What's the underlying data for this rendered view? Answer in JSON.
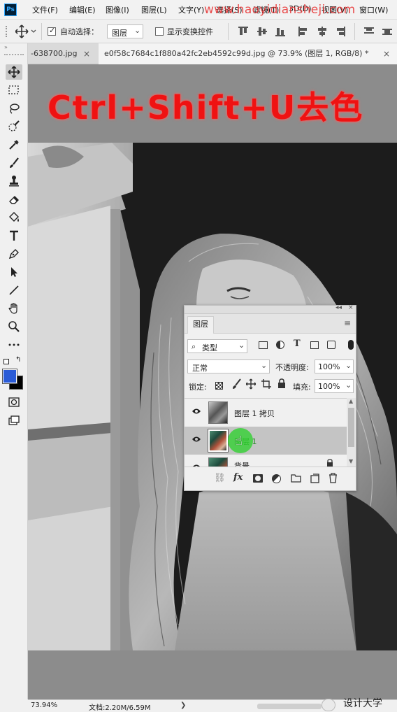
{
  "menubar": {
    "logo": "Ps",
    "items": [
      "文件(F)",
      "编辑(E)",
      "图像(I)",
      "图层(L)",
      "文字(Y)",
      "选择(S)",
      "滤镜(T)",
      "3D(D)",
      "视图(V)",
      "窗口(W)"
    ],
    "watermark": "www.haoyidiansheji.com"
  },
  "options": {
    "auto_select_label": "自动选择：",
    "auto_select_checked": true,
    "auto_select_value": "图层",
    "show_transform_label": "显示变换控件",
    "show_transform_checked": false
  },
  "tabs": [
    {
      "label": "-638700.jpg",
      "active": false
    },
    {
      "label": "e0f58c7684c1f880a42fc2eb4592c99d.jpg @ 73.9% (图层 1, RGB/8) *",
      "active": true
    }
  ],
  "tool_icons": [
    "move-icon",
    "marquee-icon",
    "lasso-icon",
    "quick-select-icon",
    "eyedropper-icon",
    "brush-icon",
    "stamp-icon",
    "eraser-icon",
    "paint-bucket-icon",
    "type-icon",
    "pen-icon",
    "path-select-icon",
    "line-icon",
    "hand-icon",
    "zoom-icon",
    "more-icon"
  ],
  "colors": {
    "foreground": "#2a5bd7",
    "background": "#000000",
    "headline": "#ef1212",
    "selection_bg": "#c4c4c4"
  },
  "canvas": {
    "headline": "Ctrl+Shift+U去色"
  },
  "layers_panel": {
    "tab_label": "图层",
    "filter_kind": "类型",
    "blend_mode": "正常",
    "opacity_label": "不透明度:",
    "opacity_value": "100%",
    "lock_label": "锁定:",
    "fill_label": "填充:",
    "fill_value": "100%",
    "layers": [
      {
        "name": "图层 1 拷贝",
        "visible": true,
        "selected": false,
        "thumb": "bw"
      },
      {
        "name": "图层 1",
        "visible": true,
        "selected": true,
        "thumb": "color"
      },
      {
        "name": "背景",
        "visible": true,
        "selected": false,
        "thumb": "color"
      }
    ],
    "footer_icons": [
      "link-icon",
      "fx-icon",
      "mask-icon",
      "adjustment-icon",
      "folder-icon",
      "new-layer-icon",
      "trash-icon"
    ]
  },
  "status": {
    "zoom": "73.94%",
    "doc_info": "文档:2.20M/6.59M",
    "arrow": "❯"
  },
  "brand": {
    "label": "设计大学"
  }
}
